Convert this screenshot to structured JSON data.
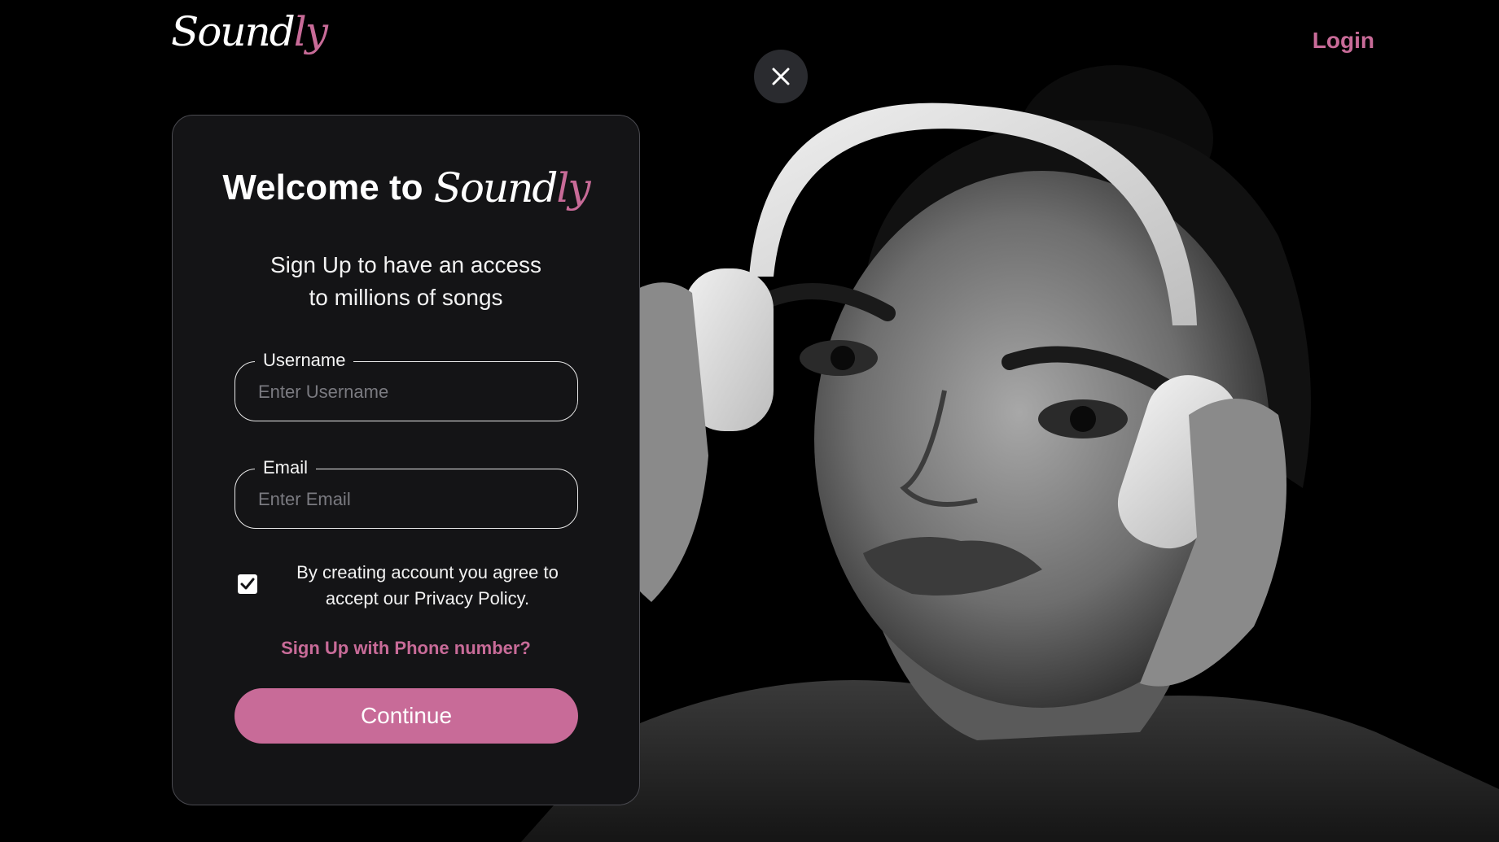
{
  "header": {
    "logo_main": "Sound",
    "logo_accent": "ly",
    "login_label": "Login"
  },
  "close_icon": "close-icon",
  "card": {
    "welcome_prefix": "Welcome to",
    "logo_main": "Sound",
    "logo_accent": "ly",
    "subtitle_line1": "Sign Up to have an access",
    "subtitle_line2": "to millions of songs",
    "username": {
      "label": "Username",
      "placeholder": "Enter Username",
      "value": ""
    },
    "email": {
      "label": "Email",
      "placeholder": "Enter Email",
      "value": ""
    },
    "agreement": {
      "checked": true,
      "line1": "By creating account you agree to",
      "line2": "accept our Privacy Policy."
    },
    "phone_link": "Sign Up with Phone number?",
    "continue_label": "Continue"
  },
  "colors": {
    "accent": "#c86b98",
    "background": "#000000",
    "card_background": "#141416",
    "close_button": "#2a2b2f"
  }
}
